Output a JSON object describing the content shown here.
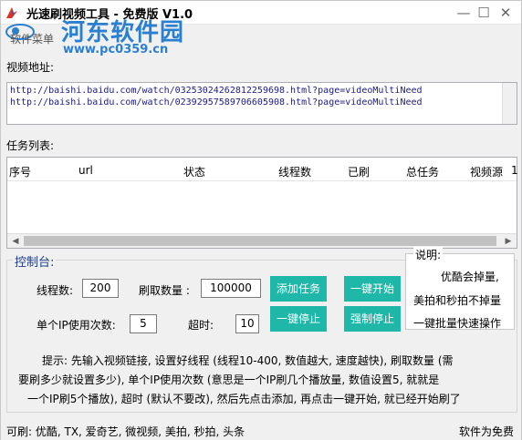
{
  "titlebar": {
    "title": "光速刷视频工具 - 免费版 V1.0"
  },
  "watermark": {
    "site_name": "河东软件园",
    "url": "www.pc0359.cn"
  },
  "menu": {
    "item": "软件菜单"
  },
  "video_url": {
    "label": "视频地址:",
    "lines": [
      "http://baishi.baidu.com/watch/03253024262812259698.html?page=videoMultiNeed",
      "http://baishi.baidu.com/watch/02392957589706605908.html?page=videoMultiNeed"
    ]
  },
  "task_list": {
    "label": "任务列表:",
    "columns": [
      "序号",
      "url",
      "状态",
      "线程数",
      "已刷",
      "总任务",
      "视频源",
      "1"
    ]
  },
  "control": {
    "title": "控制台:",
    "threads_label": "线程数:",
    "threads_value": "200",
    "count_label": "刷取数量 :",
    "count_value": "100000",
    "per_ip_label": "单个IP使用次数:",
    "per_ip_value": "5",
    "timeout_label": "超时:",
    "timeout_value": "10",
    "add_task": "添加任务",
    "start": "一键开始",
    "stop": "一键停止",
    "force_stop": "强制停止"
  },
  "description": {
    "title": "说明:",
    "line1": "优酷会掉量,",
    "line2": "美拍和秒拍不掉量",
    "line3": "一键批量快速操作"
  },
  "tips": {
    "line1": "提示: 先输入视频链接, 设置好线程 (线程10-400, 数值越大, 速度越快), 刷取数量 (需",
    "line2": "要刷多少就设置多少), 单个IP使用次数 (意思是一个IP刷几个播放量, 数值设置5, 就就是",
    "line3": "一个IP刷5个播放), 超时 (默认不要改), 然后先点击添加, 再点击一键开始, 就已经开始刷了"
  },
  "status": {
    "left": "可刷: 优酷, TX, 爱奇艺, 微视频, 美拍, 秒拍, 头条",
    "right": "软件为免费"
  }
}
